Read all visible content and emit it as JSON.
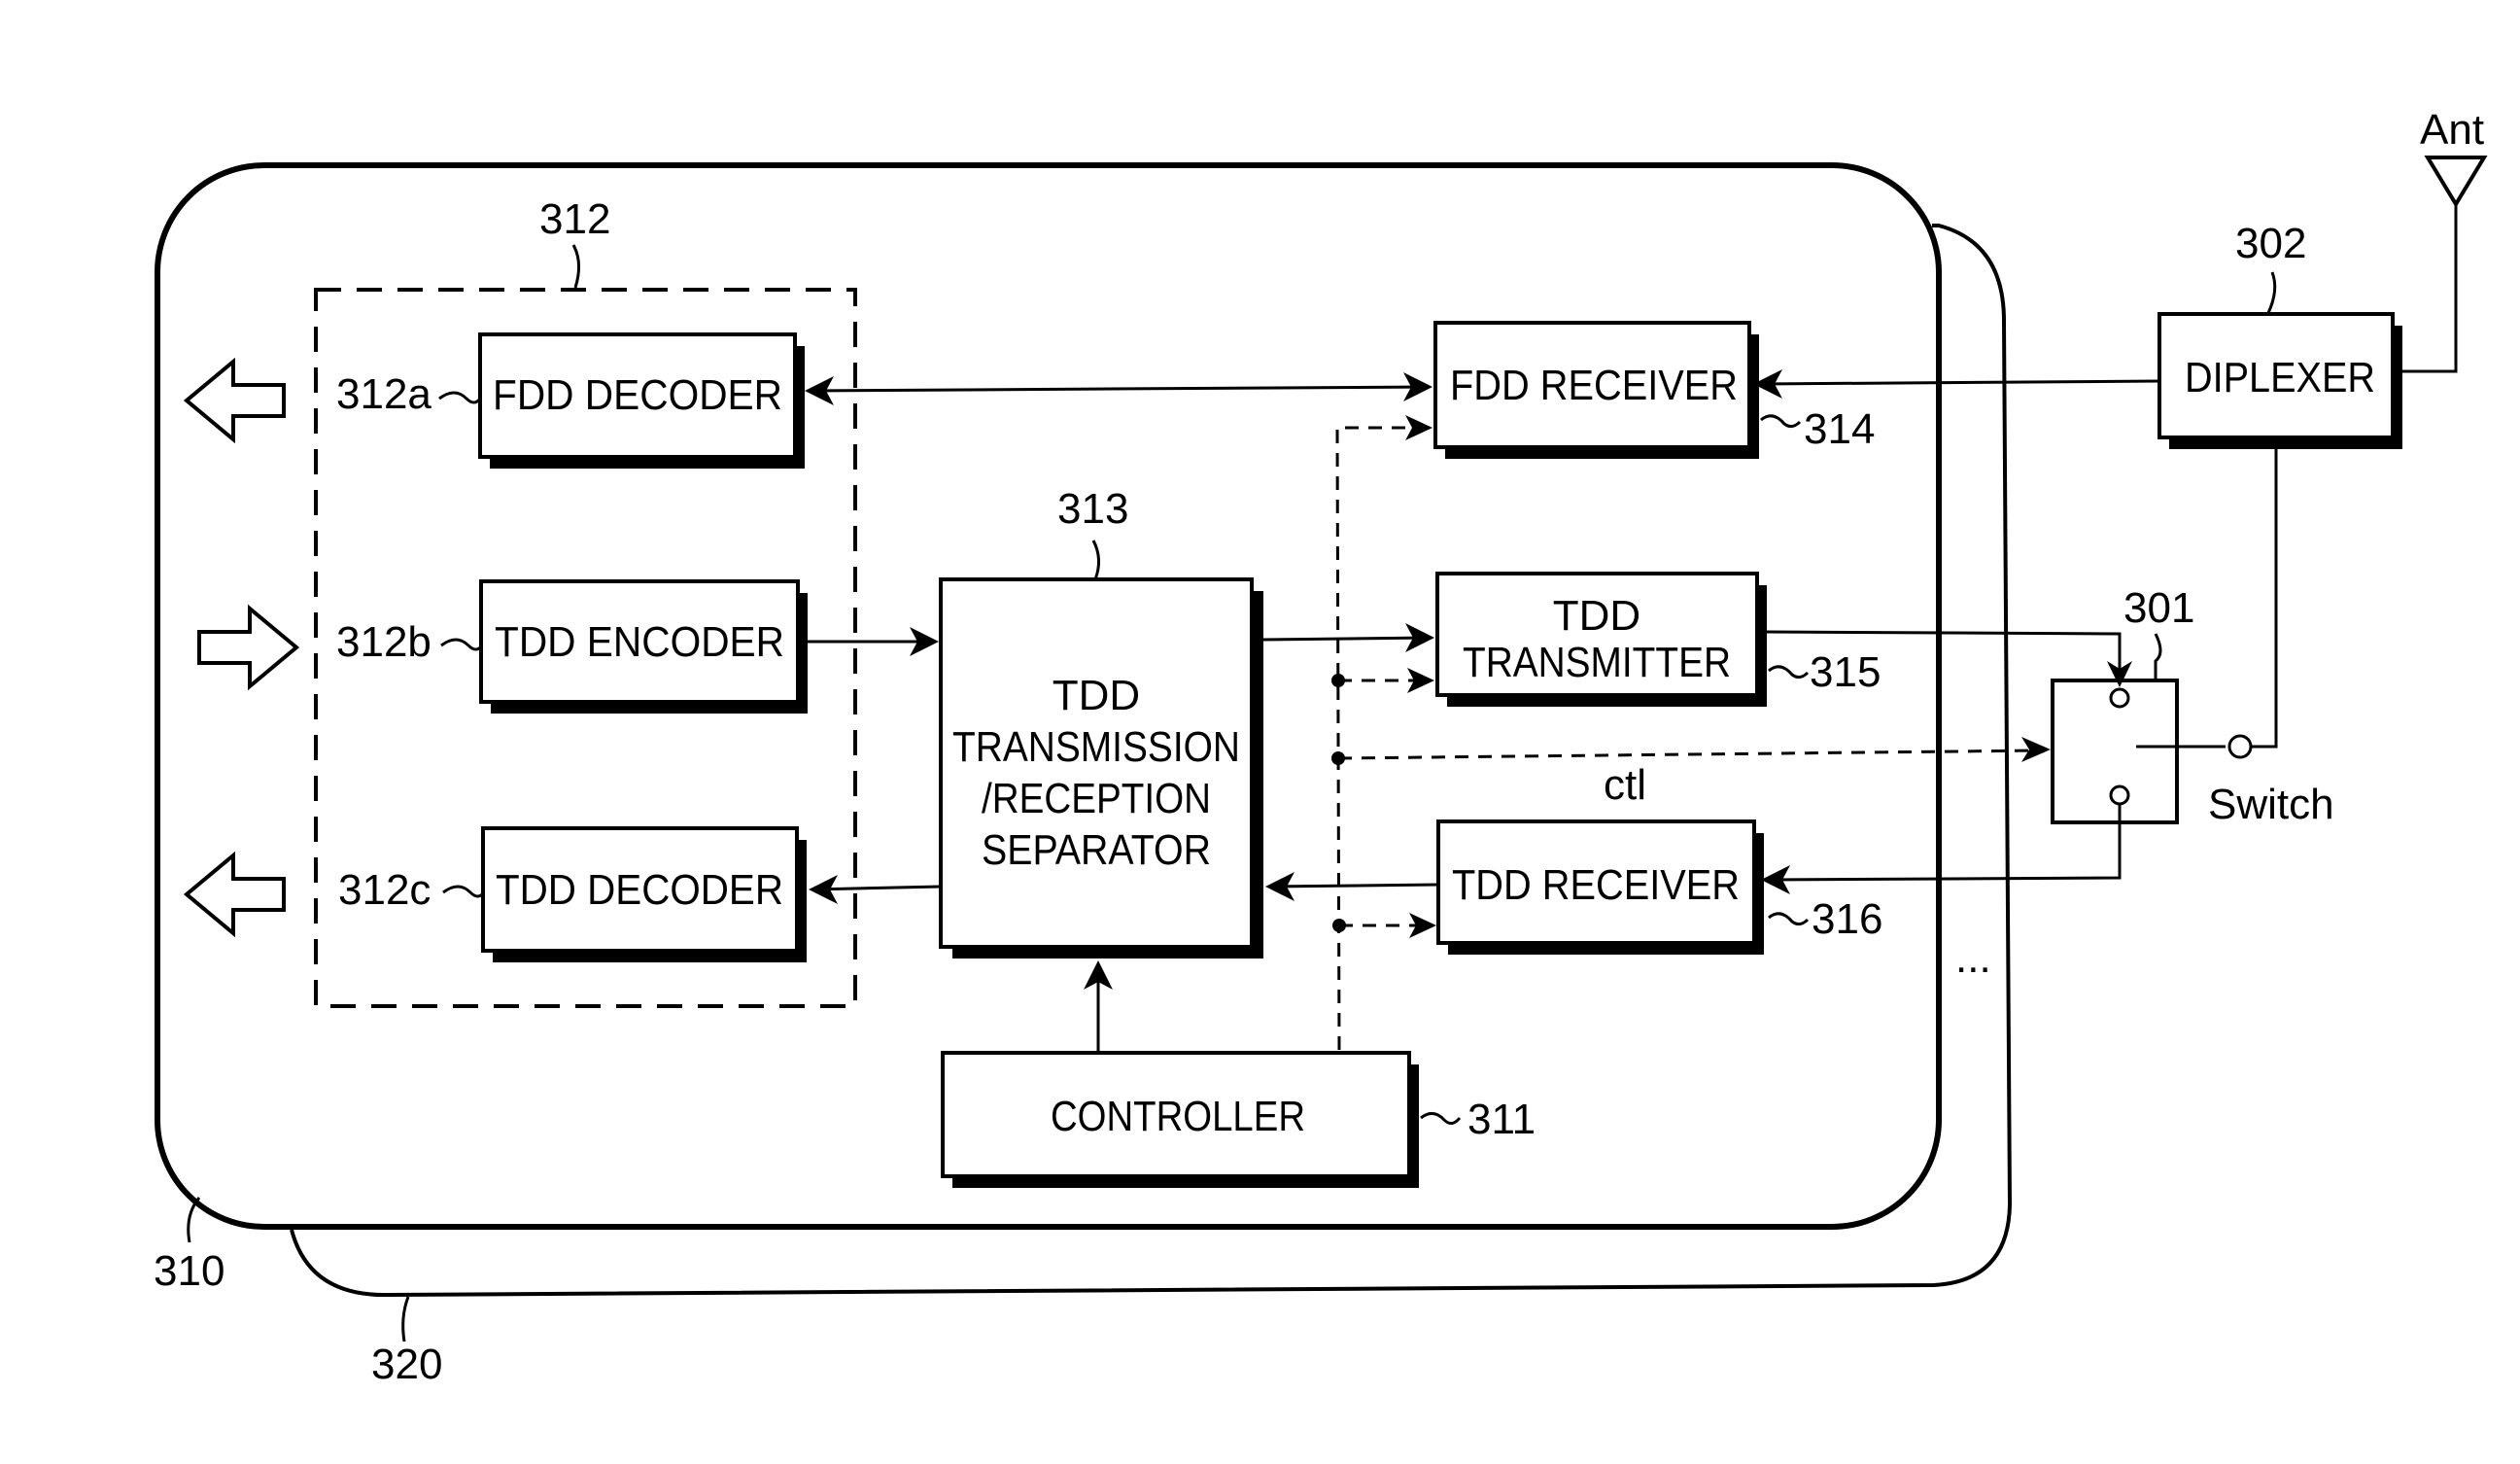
{
  "diagram": {
    "type": "block-diagram",
    "title": "",
    "antenna": {
      "label": "Ant"
    },
    "diplexer": {
      "label": "DIPLEXER",
      "ref": "302"
    },
    "switch": {
      "label": "Switch",
      "ref": "301"
    },
    "control_signal": {
      "label": "ctl"
    },
    "boards": [
      {
        "ref": "310"
      },
      {
        "ref": "320"
      }
    ],
    "ellipsis": "...",
    "codec_group": {
      "ref": "312"
    },
    "blocks": {
      "fdd_decoder": {
        "label": "FDD DECODER",
        "ref": "312a"
      },
      "tdd_encoder": {
        "label": "TDD ENCODER",
        "ref": "312b"
      },
      "tdd_decoder": {
        "label": "TDD DECODER",
        "ref": "312c"
      },
      "separator": {
        "lines": [
          "TDD",
          "TRANSMISSION",
          "/RECEPTION",
          "SEPARATOR"
        ],
        "ref": "313"
      },
      "controller": {
        "label": "CONTROLLER",
        "ref": "311"
      },
      "fdd_receiver": {
        "label": "FDD RECEIVER",
        "ref": "314"
      },
      "tdd_transmitter": {
        "lines": [
          "TDD",
          "TRANSMITTER"
        ],
        "ref": "315"
      },
      "tdd_receiver": {
        "label": "TDD RECEIVER",
        "ref": "316"
      }
    },
    "connections": [
      {
        "from": "Ant",
        "to": "DIPLEXER"
      },
      {
        "from": "DIPLEXER",
        "to": "FDD RECEIVER"
      },
      {
        "from": "FDD RECEIVER",
        "to": "FDD DECODER"
      },
      {
        "from": "DIPLEXER",
        "to": "Switch"
      },
      {
        "from": "TDD TRANSMITTER",
        "to": "Switch"
      },
      {
        "from": "Switch",
        "to": "TDD RECEIVER"
      },
      {
        "from": "TDD ENCODER",
        "to": "TDD TRANSMISSION/RECEPTION SEPARATOR"
      },
      {
        "from": "TDD TRANSMISSION/RECEPTION SEPARATOR",
        "to": "TDD TRANSMITTER"
      },
      {
        "from": "TDD RECEIVER",
        "to": "TDD TRANSMISSION/RECEPTION SEPARATOR"
      },
      {
        "from": "TDD TRANSMISSION/RECEPTION SEPARATOR",
        "to": "TDD DECODER"
      },
      {
        "from": "CONTROLLER",
        "to": "TDD TRANSMISSION/RECEPTION SEPARATOR"
      },
      {
        "from": "CONTROLLER",
        "to": "FDD RECEIVER",
        "style": "dashed"
      },
      {
        "from": "CONTROLLER",
        "to": "TDD TRANSMITTER",
        "style": "dashed"
      },
      {
        "from": "CONTROLLER",
        "to": "TDD RECEIVER",
        "style": "dashed"
      },
      {
        "from": "CONTROLLER",
        "to": "Switch",
        "style": "dashed",
        "label": "ctl"
      }
    ]
  }
}
